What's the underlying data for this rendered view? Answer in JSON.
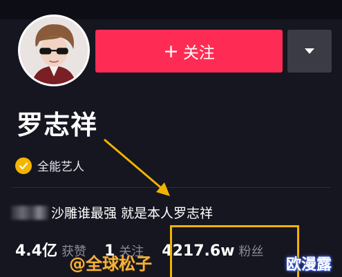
{
  "profile": {
    "name": "罗志祥",
    "verification": {
      "icon": "check-badge-icon",
      "label": "全能艺人",
      "color": "#f4b500"
    },
    "bio": "沙雕谁最强 就是本人罗志祥",
    "stats": {
      "likes_value": "4.4亿",
      "likes_label": "获赞",
      "following_value": "1",
      "following_label": "关注",
      "followers_value": "4217.6w",
      "followers_label": "粉丝"
    }
  },
  "actions": {
    "follow_label": "关注",
    "follow_icon": "plus-icon",
    "more_icon": "triangle-down-icon",
    "follow_color": "#fe2c55"
  },
  "overlays": {
    "watermark": "@全球松子",
    "site_mark": "欧漫露",
    "annotation_color": "#f2b300"
  }
}
